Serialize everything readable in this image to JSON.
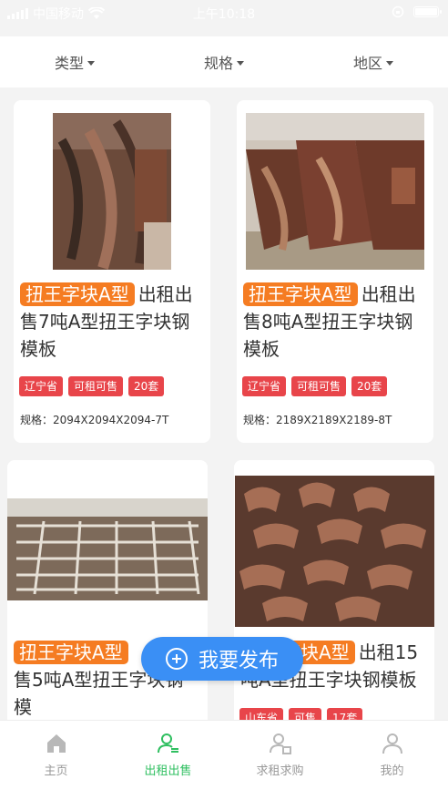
{
  "status_bar": {
    "carrier": "中国移动",
    "time": "上午10:18",
    "icons": [
      "signal-icon",
      "wifi-icon",
      "rotation-lock-icon",
      "battery-icon"
    ]
  },
  "filters": [
    {
      "label": "类型"
    },
    {
      "label": "规格"
    },
    {
      "label": "地区"
    }
  ],
  "listings": [
    {
      "tag": "扭王字块A型",
      "title_line1": "出租出",
      "title_line2": "售7吨A型扭王字块钢",
      "title_line3": "模板",
      "badges": [
        "辽宁省",
        "可租可售",
        "20套"
      ],
      "spec": "规格：2094X2094X2094-7T"
    },
    {
      "tag": "扭王字块A型",
      "title_line1": "出租出",
      "title_line2": "售8吨A型扭王字块钢",
      "title_line3": "模板",
      "badges": [
        "辽宁省",
        "可租可售",
        "20套"
      ],
      "spec": "规格：2189X2189X2189-8T"
    },
    {
      "tag": "扭王字块A型",
      "title_line2": "售5吨A型扭王字块钢",
      "title_line3": "模"
    },
    {
      "tag": "扭王字块A型",
      "title_line1": "出租15",
      "title_line2": "吨A型扭王字块钢模板",
      "badges": [
        "山东省",
        "可售",
        "17套"
      ]
    }
  ],
  "publish_button": {
    "label": "我要发布"
  },
  "tabs": [
    {
      "label": "主页",
      "icon": "home-icon",
      "active": false
    },
    {
      "label": "出租出售",
      "icon": "person-list-icon",
      "active": true
    },
    {
      "label": "求租求购",
      "icon": "person-search-icon",
      "active": false
    },
    {
      "label": "我的",
      "icon": "profile-icon",
      "active": false
    }
  ],
  "colors": {
    "accent": "#2fbf60",
    "tag_orange": "#f57c22",
    "badge_red": "#e8454a",
    "publish_blue": "#3a8ff5"
  }
}
